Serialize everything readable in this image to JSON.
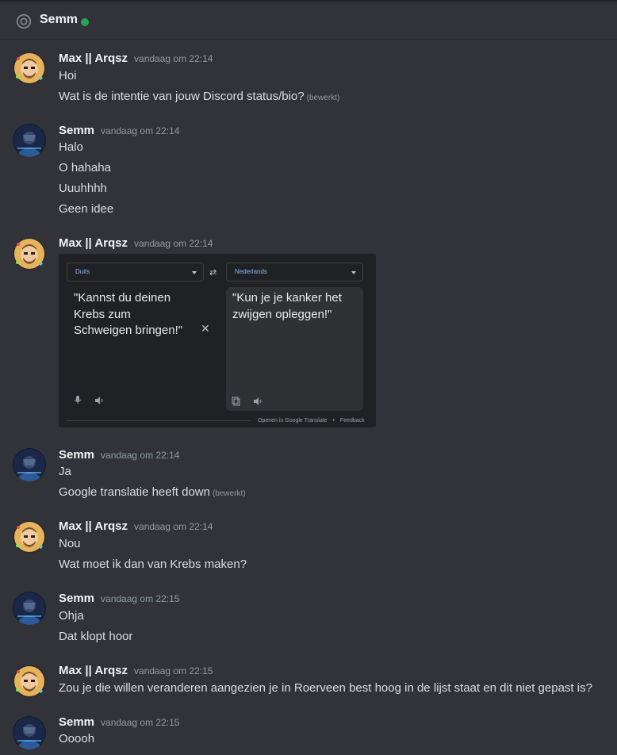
{
  "header": {
    "title": "Semm",
    "status_color": "#23a55a"
  },
  "messages": [
    {
      "author": "Max || Arqsz",
      "timestamp": "vandaag om 22:14",
      "lines": [
        "Hoi",
        "Wat is de intentie van jouw Discord status/bio?"
      ],
      "edited": "(bewerkt)"
    },
    {
      "author": "Semm",
      "timestamp": "vandaag om 22:14",
      "lines": [
        "Halo",
        "O hahaha",
        "Uuuhhhh",
        "Geen idee"
      ]
    },
    {
      "author": "Max || Arqsz",
      "timestamp": "vandaag om 22:14"
    },
    {
      "author": "Semm",
      "timestamp": "vandaag om 22:14",
      "lines": [
        "Ja",
        "Google translatie heeft down"
      ],
      "edited": "(bewerkt)"
    },
    {
      "author": "Max || Arqsz",
      "timestamp": "vandaag om 22:14",
      "lines": [
        "Nou",
        "Wat moet ik dan van Krebs maken?"
      ]
    },
    {
      "author": "Semm",
      "timestamp": "vandaag om 22:15",
      "lines": [
        "Ohja",
        "Dat klopt hoor"
      ]
    },
    {
      "author": "Max || Arqsz",
      "timestamp": "vandaag om 22:15",
      "lines": [
        "Zou je die willen veranderen aangezien je in Roerveen best hoog in de lijst staat en dit niet gepast is?"
      ]
    },
    {
      "author": "Semm",
      "timestamp": "vandaag om 22:15",
      "lines": [
        "Ooooh"
      ]
    }
  ],
  "translate": {
    "source_lang": "Duits",
    "target_lang": "Nederlands",
    "source_text": "\"Kannst du deinen Krebs zum Schweigen bringen!\"",
    "target_text": "\"Kun je je kanker het zwijgen opleggen!\"",
    "open_link": "Openen in Google Translate",
    "separator": "•",
    "feedback": "Feedback"
  }
}
